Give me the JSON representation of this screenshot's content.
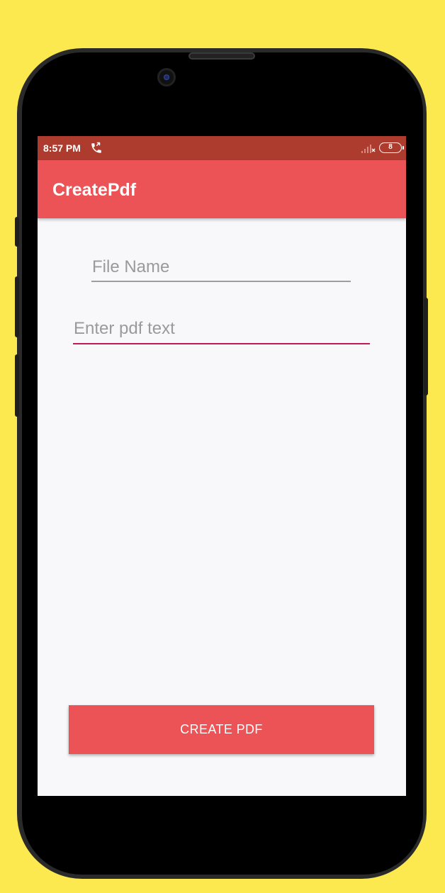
{
  "status_bar": {
    "time": "8:57 PM",
    "call_icon": "phone-forward-icon",
    "signal_icon": "signal-icon",
    "battery_level": "8"
  },
  "app_bar": {
    "title": "CreatePdf",
    "color": "#eb5356"
  },
  "form": {
    "file_name": {
      "value": "",
      "placeholder": "File Name"
    },
    "pdf_text": {
      "value": "",
      "placeholder": "Enter pdf text"
    },
    "create_button_label": "CREATE PDF"
  },
  "colors": {
    "background": "#fbe94f",
    "status_bar": "#ad3c2f",
    "accent": "#eb5356",
    "focus_underline": "#c2185b"
  }
}
